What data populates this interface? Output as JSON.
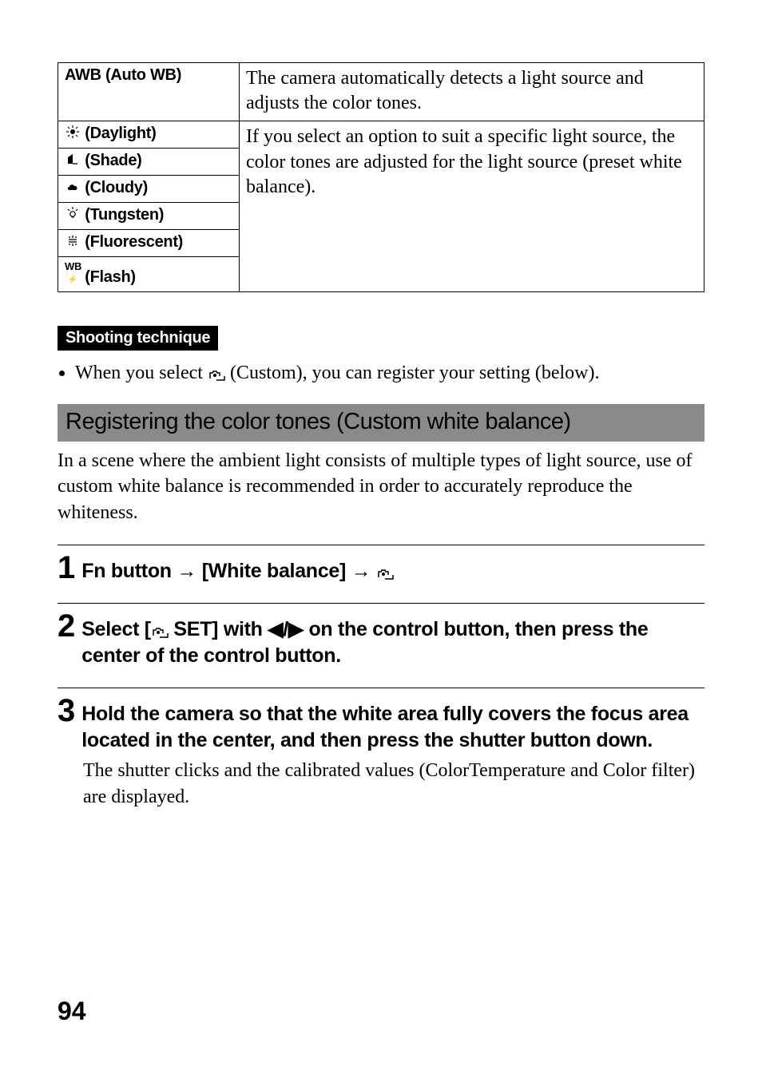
{
  "wb_table": {
    "rows": [
      {
        "label": "AWB (Auto WB)",
        "icon": ""
      },
      {
        "label": "(Daylight)",
        "icon": "sun"
      },
      {
        "label": "(Shade)",
        "icon": "shade"
      },
      {
        "label": "(Cloudy)",
        "icon": "cloud"
      },
      {
        "label": "(Tungsten)",
        "icon": "bulb"
      },
      {
        "label": "(Fluorescent)",
        "icon": "fluor"
      },
      {
        "label": "(Flash)",
        "icon": "flash"
      }
    ],
    "desc_auto": "The camera automatically detects a light source and adjusts the color tones.",
    "desc_preset": "If you select an option to suit a specific light source, the color tones are adjusted for the light source (preset white balance)."
  },
  "technique": {
    "badge": "Shooting technique",
    "bullet_pre": "When you select ",
    "bullet_post": " (Custom), you can register your setting (below)."
  },
  "section": {
    "title": "Registering the color tones (Custom white balance)",
    "body": "In a scene where the ambient light consists of multiple types of light source, use of custom white balance is recommended in order to accurately reproduce the whiteness."
  },
  "steps": {
    "s1": {
      "num": "1",
      "text_a": "Fn button ",
      "text_b": " [White balance] ",
      "text_c": " "
    },
    "s2": {
      "num": "2",
      "text_a": "Select [",
      "text_b": " SET] with ",
      "text_c": " on the control button, then press the center of the control button."
    },
    "s3": {
      "num": "3",
      "text": "Hold the camera so that the white area fully covers the focus area located in the center, and then press the shutter button down.",
      "desc": "The shutter clicks and the calibrated values (ColorTemperature and Color filter) are displayed."
    }
  },
  "icons": {
    "arrow_right": "→",
    "tri_left": "◀",
    "tri_right": "▶",
    "slash": "/"
  },
  "page_number": "94"
}
